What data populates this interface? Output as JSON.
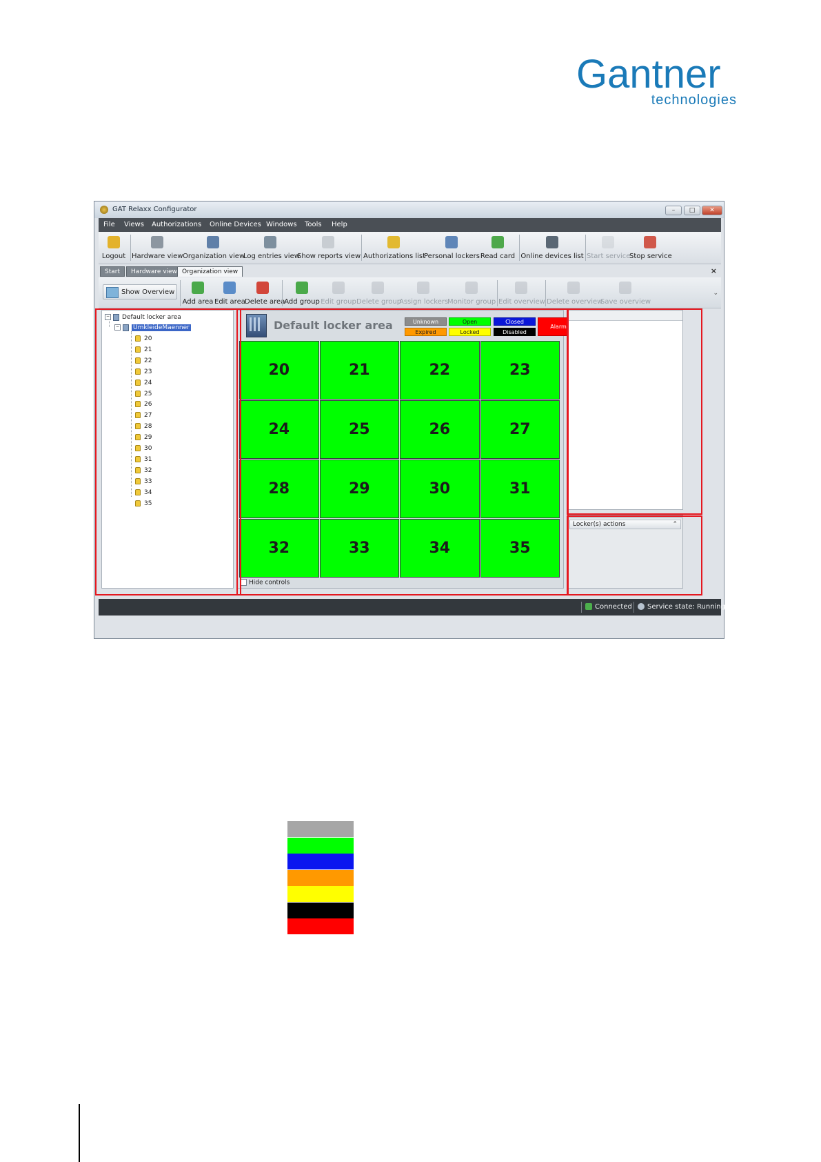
{
  "logo": {
    "main": "Gantner",
    "sub": "technologies"
  },
  "window": {
    "title": "GAT Relaxx Configurator",
    "buttons": {
      "minimize": "–",
      "maximize": "□",
      "close": "✕"
    }
  },
  "menu": [
    "File",
    "Views",
    "Authorizations",
    "Online Devices",
    "Windows",
    "Tools",
    "Help"
  ],
  "toolbar": [
    {
      "label": "Logout",
      "icon": "key-icon",
      "color": "#e3b22b"
    },
    {
      "label": "Hardware view",
      "icon": "hardware-icon",
      "color": "#8c96a0"
    },
    {
      "label": "Organization view",
      "icon": "building-icon",
      "color": "#5f7fa8"
    },
    {
      "label": "Log entries view",
      "icon": "log-icon",
      "color": "#7d8f9e"
    },
    {
      "label": "Show reports view",
      "icon": "report-icon",
      "color": "#c8cdd2"
    },
    {
      "label": "Authorizations list",
      "icon": "authorizations-icon",
      "color": "#e2b930"
    },
    {
      "label": "Personal lockers",
      "icon": "personal-lockers-icon",
      "color": "#5f86b8"
    },
    {
      "label": "Read card",
      "icon": "read-card-icon",
      "color": "#4ea84a"
    },
    {
      "label": "Online devices list",
      "icon": "device-icon",
      "color": "#5a6774"
    },
    {
      "label": "Start service",
      "icon": "start-service-icon",
      "color": "#b8bec4"
    },
    {
      "label": "Stop service",
      "icon": "stop-service-icon",
      "color": "#d0584a"
    }
  ],
  "tabs": [
    "Start",
    "Hardware view",
    "Organization view"
  ],
  "tab_close": "×",
  "org_toolbar": {
    "show_overview": "Show Overview",
    "buttons": [
      {
        "label": "Add area",
        "icon": "add-area-icon",
        "color": "#4aa94a",
        "disabled": false
      },
      {
        "label": "Edit area",
        "icon": "edit-area-icon",
        "color": "#5a8cc8",
        "disabled": false
      },
      {
        "label": "Delete area",
        "icon": "delete-area-icon",
        "color": "#d2463a",
        "disabled": false
      },
      {
        "label": "Add group",
        "icon": "add-group-icon",
        "color": "#4aa94a",
        "disabled": false
      },
      {
        "label": "Edit group",
        "icon": "edit-group-icon",
        "color": "#9aa1a8",
        "disabled": true
      },
      {
        "label": "Delete group",
        "icon": "delete-group-icon",
        "color": "#9aa1a8",
        "disabled": true
      },
      {
        "label": "Assign lockers",
        "icon": "assign-lockers-icon",
        "color": "#9aa1a8",
        "disabled": true
      },
      {
        "label": "Monitor group",
        "icon": "monitor-group-icon",
        "color": "#9aa1a8",
        "disabled": true
      },
      {
        "label": "Edit overview",
        "icon": "edit-overview-icon",
        "color": "#9aa1a8",
        "disabled": true
      },
      {
        "label": "Delete overview",
        "icon": "delete-overview-icon",
        "color": "#9aa1a8",
        "disabled": true
      },
      {
        "label": "Save overview",
        "icon": "save-overview-icon",
        "color": "#9aa1a8",
        "disabled": true
      }
    ],
    "chevron": "⌄"
  },
  "tree": {
    "root": "Default locker area",
    "group": "UmkleideMaenner",
    "lockers": [
      "20",
      "21",
      "22",
      "23",
      "24",
      "25",
      "26",
      "27",
      "28",
      "29",
      "30",
      "31",
      "32",
      "33",
      "34",
      "35"
    ]
  },
  "overview": {
    "title": "Default locker area",
    "legend": [
      {
        "label": "Unknown",
        "color": "#8c8c8c",
        "text_color": "#ffffff"
      },
      {
        "label": "Open",
        "color": "#00ff00",
        "text_color": "#1a1a1a"
      },
      {
        "label": "Closed",
        "color": "#0a16d8",
        "text_color": "#ffffff"
      },
      {
        "label": "Expired",
        "color": "#ff9900",
        "text_color": "#1a1a1a"
      },
      {
        "label": "Locked",
        "color": "#ffff00",
        "text_color": "#1a1a1a"
      },
      {
        "label": "Disabled",
        "color": "#000000",
        "text_color": "#ffffff"
      }
    ],
    "alarm": {
      "label": "Alarm",
      "color": "#ff0000"
    },
    "lockers": [
      "20",
      "21",
      "22",
      "23",
      "24",
      "25",
      "26",
      "27",
      "28",
      "29",
      "30",
      "31",
      "32",
      "33",
      "34",
      "35"
    ],
    "locker_state_color": "#00ff00",
    "hide_controls": "Hide controls"
  },
  "actions_panel": {
    "title": "Locker(s) actions",
    "toggle": "⌃"
  },
  "status": {
    "connected": "Connected",
    "service": "Service state: Running"
  },
  "color_key": [
    "#a6a6a6",
    "#00ff00",
    "#0a16f0",
    "#ff9900",
    "#ffff00",
    "#000000",
    "#ff0000"
  ]
}
